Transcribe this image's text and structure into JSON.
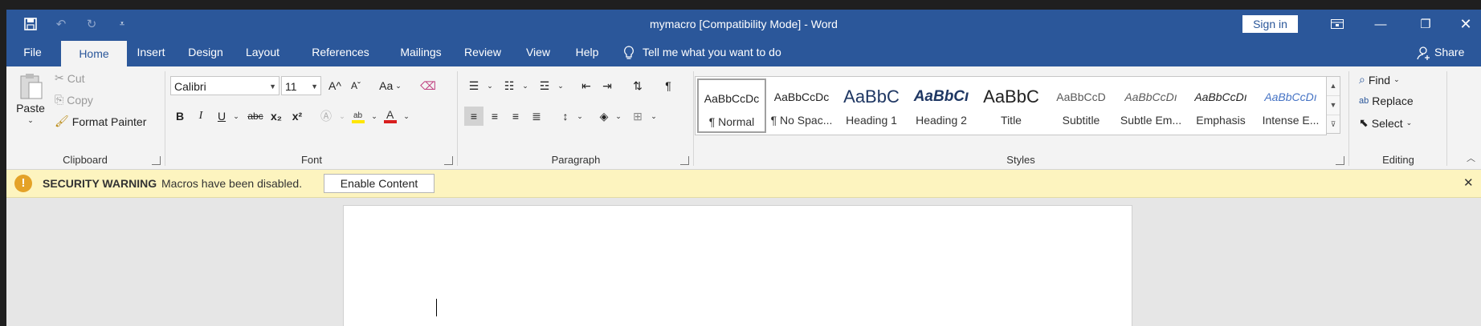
{
  "window": {
    "title": "mymacro [Compatibility Mode]  -  Word",
    "sign_in": "Sign in",
    "controls": {
      "ribbon_display_icon": "ribbon-display-icon",
      "minimize_icon": "minimize-icon",
      "restore_icon": "restore-icon",
      "close_icon": "close-icon"
    }
  },
  "qat": {
    "save_icon": "save-icon",
    "undo_icon": "undo-icon",
    "redo_icon": "redo-icon",
    "customize_icon": "customize-icon"
  },
  "tabs": [
    "File",
    "Home",
    "Insert",
    "Design",
    "Layout",
    "References",
    "Mailings",
    "Review",
    "View",
    "Help"
  ],
  "active_tab": "Home",
  "tell_me": "Tell me what you want to do",
  "share": "Share",
  "clipboard": {
    "label": "Clipboard",
    "paste": "Paste",
    "cut": "Cut",
    "copy": "Copy",
    "format_painter": "Format Painter"
  },
  "font": {
    "label": "Font",
    "name": "Calibri",
    "size": "11",
    "change_case": "Aa",
    "bold": "B",
    "italic": "I",
    "underline": "U",
    "strikethrough": "abc",
    "subscript": "x₂",
    "superscript": "x²",
    "grow": "A^",
    "shrink": "Aˇ",
    "highlight_color": "#ffe600",
    "font_color": "#d81e1e"
  },
  "paragraph": {
    "label": "Paragraph"
  },
  "styles": {
    "label": "Styles",
    "items": [
      {
        "preview": "AaBbCcDc",
        "name": "¶ Normal"
      },
      {
        "preview": "AaBbCcDc",
        "name": "¶ No Spac..."
      },
      {
        "preview": "AaBbC",
        "name": "Heading 1"
      },
      {
        "preview": "AaBbCı",
        "name": "Heading 2"
      },
      {
        "preview": "AaBbC",
        "name": "Title"
      },
      {
        "preview": "AaBbCcD",
        "name": "Subtitle"
      },
      {
        "preview": "AaBbCcDı",
        "name": "Subtle Em..."
      },
      {
        "preview": "AaBbCcDı",
        "name": "Emphasis"
      },
      {
        "preview": "AaBbCcDı",
        "name": "Intense E..."
      }
    ]
  },
  "editing": {
    "label": "Editing",
    "find": "Find",
    "replace": "Replace",
    "select": "Select"
  },
  "security": {
    "title": "SECURITY WARNING",
    "message": "Macros have been disabled.",
    "button": "Enable Content"
  },
  "colors": {
    "accent": "#2b579a",
    "warning_bg": "#fdf4bf"
  }
}
